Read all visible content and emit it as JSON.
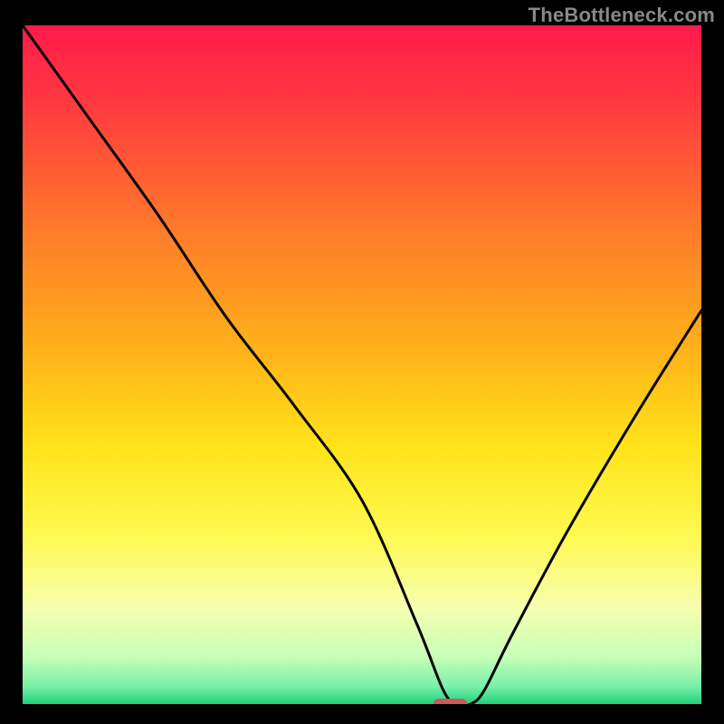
{
  "watermark": "TheBottleneck.com",
  "chart_data": {
    "type": "line",
    "title": "",
    "xlabel": "",
    "ylabel": "",
    "xlim": [
      0,
      100
    ],
    "ylim": [
      0,
      100
    ],
    "x": [
      0,
      10,
      20,
      30,
      40,
      50,
      58,
      62,
      64,
      66,
      68,
      72,
      80,
      90,
      100
    ],
    "values": [
      100,
      86,
      72,
      57,
      44,
      30,
      12,
      2,
      0,
      0,
      2,
      10,
      25,
      42,
      58
    ],
    "note": "V-shaped bottleneck curve; minimum ≈ x 63–67 at y ≈ 0. Right arm rises to ≈ 58 at x = 100.",
    "marker": {
      "x": 63,
      "y": 0,
      "width": 5,
      "height": 1.6
    },
    "background_gradient": {
      "stops": [
        {
          "offset": 0.0,
          "color": "#ff1a4b"
        },
        {
          "offset": 0.12,
          "color": "#ff3b3f"
        },
        {
          "offset": 0.3,
          "color": "#ff7a2a"
        },
        {
          "offset": 0.48,
          "color": "#ffb21a"
        },
        {
          "offset": 0.62,
          "color": "#ffe31a"
        },
        {
          "offset": 0.75,
          "color": "#fff94f"
        },
        {
          "offset": 0.86,
          "color": "#f6ffb0"
        },
        {
          "offset": 0.93,
          "color": "#c8ffb8"
        },
        {
          "offset": 0.975,
          "color": "#77f0a8"
        },
        {
          "offset": 1.0,
          "color": "#20d07a"
        }
      ]
    }
  }
}
